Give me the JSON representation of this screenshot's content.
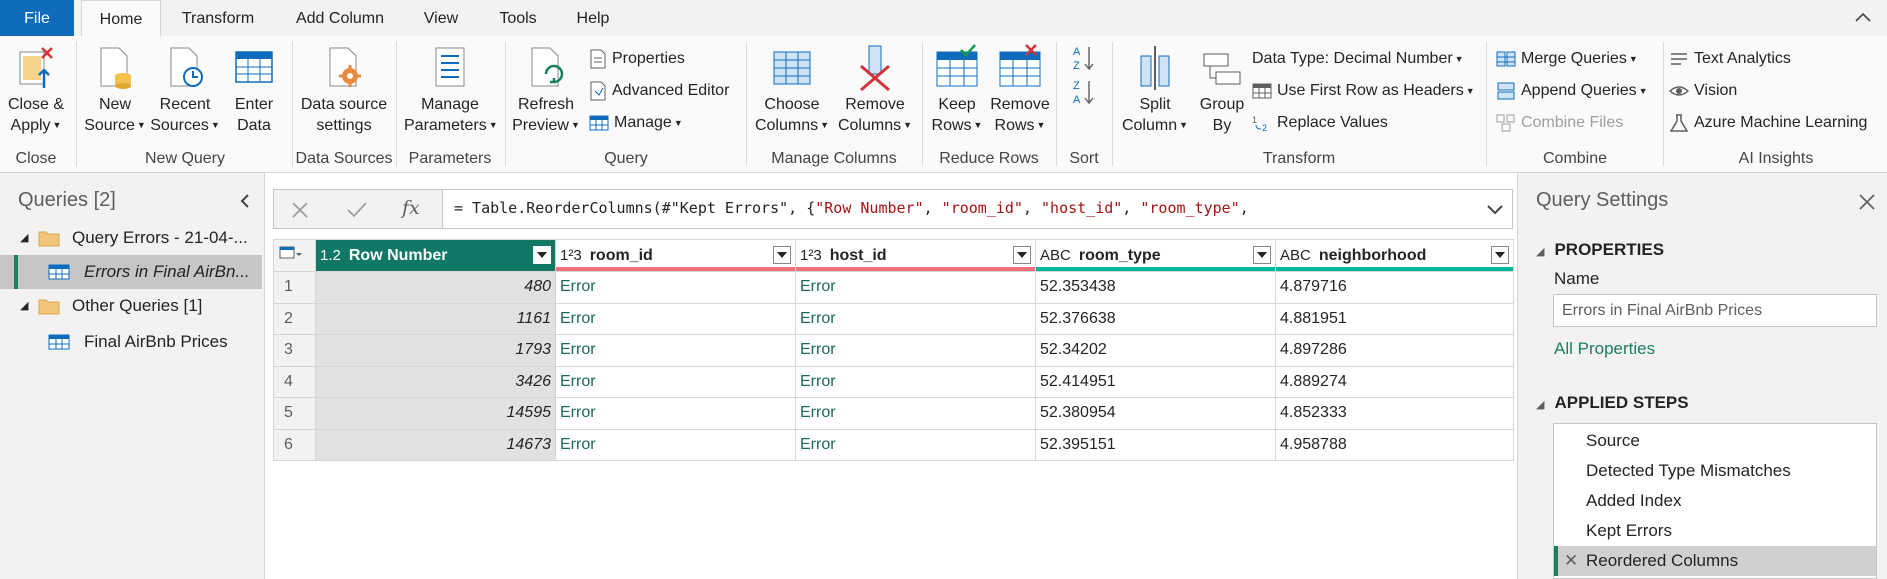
{
  "tabs": [
    "File",
    "Home",
    "Transform",
    "Add Column",
    "View",
    "Tools",
    "Help"
  ],
  "ribbon": {
    "groups": {
      "close": "Close",
      "new_query": "New Query",
      "data_sources": "Data Sources",
      "parameters": "Parameters",
      "query": "Query",
      "manage_columns": "Manage Columns",
      "reduce_rows": "Reduce Rows",
      "sort": "Sort",
      "transform": "Transform",
      "combine": "Combine",
      "ai_insights": "AI Insights"
    },
    "close_apply": [
      "Close &",
      "Apply"
    ],
    "new_source": [
      "New",
      "Source"
    ],
    "recent_sources": [
      "Recent",
      "Sources"
    ],
    "enter_data": [
      "Enter",
      "Data"
    ],
    "data_source_settings": [
      "Data source",
      "settings"
    ],
    "manage_parameters": [
      "Manage",
      "Parameters"
    ],
    "refresh_preview": [
      "Refresh",
      "Preview"
    ],
    "properties": "Properties",
    "advanced_editor": "Advanced Editor",
    "manage": "Manage",
    "choose_columns": [
      "Choose",
      "Columns"
    ],
    "remove_columns": [
      "Remove",
      "Columns"
    ],
    "keep_rows": [
      "Keep",
      "Rows"
    ],
    "remove_rows": [
      "Remove",
      "Rows"
    ],
    "split_column": [
      "Split",
      "Column"
    ],
    "group_by": [
      "Group",
      "By"
    ],
    "data_type": "Data Type: Decimal Number",
    "use_first_row": "Use First Row as Headers",
    "replace_values": "Replace Values",
    "merge_queries": "Merge Queries",
    "append_queries": "Append Queries",
    "combine_files": "Combine Files",
    "text_analytics": "Text Analytics",
    "vision": "Vision",
    "azure_ml": "Azure Machine Learning"
  },
  "queries_pane": {
    "title": "Queries [2]",
    "items": [
      {
        "label": "Query Errors - 21-04-...",
        "type": "folder"
      },
      {
        "label": "Errors in Final AirBn...",
        "type": "table",
        "selected": true
      },
      {
        "label": "Other Queries [1]",
        "type": "folder"
      },
      {
        "label": "Final AirBnb Prices",
        "type": "table"
      }
    ]
  },
  "formula": {
    "prefix": "= Table.ReorderColumns(#\"Kept Errors\", {",
    "args": [
      "\"Row Number\"",
      "\"room_id\"",
      "\"host_id\"",
      "\"room_type\""
    ],
    "fx": "fx"
  },
  "grid": {
    "columns": [
      {
        "type_icon": "1.2",
        "name": "Row Number"
      },
      {
        "type_icon": "1²3",
        "name": "room_id"
      },
      {
        "type_icon": "1²3",
        "name": "host_id"
      },
      {
        "type_icon": "ABC",
        "name": "room_type"
      },
      {
        "type_icon": "ABC",
        "name": "neighborhood"
      }
    ],
    "rows": [
      [
        "1",
        "480",
        "Error",
        "Error",
        "52.353438",
        "4.879716"
      ],
      [
        "2",
        "1161",
        "Error",
        "Error",
        "52.376638",
        "4.881951"
      ],
      [
        "3",
        "1793",
        "Error",
        "Error",
        "52.34202",
        "4.897286"
      ],
      [
        "4",
        "3426",
        "Error",
        "Error",
        "52.414951",
        "4.889274"
      ],
      [
        "5",
        "14595",
        "Error",
        "Error",
        "52.380954",
        "4.852333"
      ],
      [
        "6",
        "14673",
        "Error",
        "Error",
        "52.395151",
        "4.958788"
      ]
    ]
  },
  "settings_pane": {
    "title": "Query Settings",
    "properties_title": "PROPERTIES",
    "name_label": "Name",
    "name_value": "Errors in Final AirBnb Prices",
    "all_properties": "All Properties",
    "applied_steps_title": "APPLIED STEPS",
    "steps": [
      "Source",
      "Detected Type Mismatches",
      "Added Index",
      "Kept Errors",
      "Reordered Columns"
    ]
  },
  "colors": {
    "accent": "#117865",
    "file_tab": "#0f6cbd",
    "error_text": "#1a6b4f",
    "quality_red": "#f1707b",
    "quality_green": "#00b7a0"
  }
}
